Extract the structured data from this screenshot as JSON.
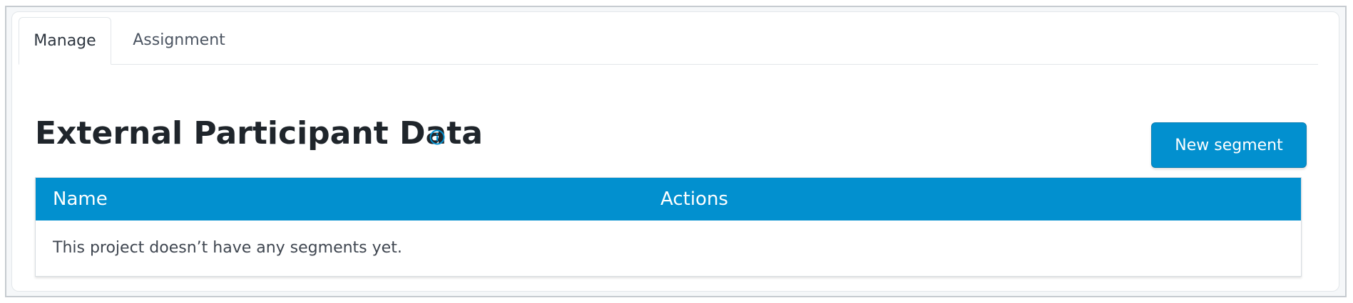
{
  "tabs": [
    {
      "label": "Manage",
      "active": true
    },
    {
      "label": "Assignment",
      "active": false
    }
  ],
  "page": {
    "title": "External Participant Data",
    "info_icon": "info-circle-icon"
  },
  "toolbar": {
    "new_segment_label": "New segment"
  },
  "table": {
    "columns": [
      "Name",
      "Actions"
    ],
    "empty_message": "This project doesn’t have any segments yet."
  },
  "colors": {
    "accent": "#0290cf",
    "header_text": "#ffffff",
    "title_text": "#1f252b"
  }
}
